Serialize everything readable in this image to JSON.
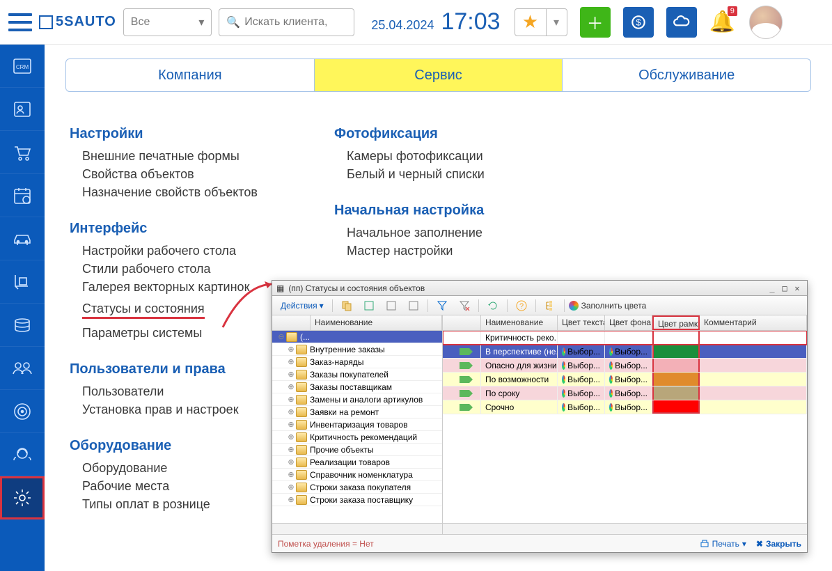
{
  "header": {
    "logo_text": "5SAUTO",
    "filter_value": "Все",
    "search_placeholder": "Искать клиента, ",
    "date": "25.04.2024",
    "time": "17:03",
    "notification_count": "9"
  },
  "sidebar_icons": [
    {
      "name": "crm-icon",
      "label": "CRM"
    },
    {
      "name": "contacts-icon"
    },
    {
      "name": "cart-icon"
    },
    {
      "name": "calendar-icon"
    },
    {
      "name": "car-icon"
    },
    {
      "name": "dolly-icon"
    },
    {
      "name": "coins-icon"
    },
    {
      "name": "group-icon"
    },
    {
      "name": "target-icon"
    },
    {
      "name": "headset-icon"
    },
    {
      "name": "settings-icon",
      "active": true
    }
  ],
  "tabs": [
    {
      "label": "Компания",
      "active": false
    },
    {
      "label": "Сервис",
      "active": true
    },
    {
      "label": "Обслуживание",
      "active": false
    }
  ],
  "settings_columns": {
    "left": [
      {
        "title": "Настройки",
        "items": [
          "Внешние печатные формы",
          "Свойства объектов",
          "Назначение свойств объектов"
        ]
      },
      {
        "title": "Интерфейс",
        "items": [
          "Настройки рабочего стола",
          "Стили рабочего стола",
          "Галерея векторных картинок",
          {
            "text": "Статусы и состояния",
            "highlight": true
          },
          "Параметры системы"
        ]
      },
      {
        "title": "Пользователи и права",
        "items": [
          "Пользователи",
          "Установка прав и настроек"
        ]
      },
      {
        "title": "Оборудование",
        "items": [
          "Оборудование",
          "Рабочие места",
          "Типы оплат в рознице"
        ]
      }
    ],
    "right": [
      {
        "title": "Фотофиксация",
        "items": [
          "Камеры фотофиксации",
          "Белый и черный списки"
        ]
      },
      {
        "title": "Начальная настройка",
        "items": [
          "Начальное заполнение",
          "Мастер настройки"
        ]
      }
    ]
  },
  "modal": {
    "title": "(пп) Статусы и состояния объектов",
    "toolbar": {
      "actions_label": "Действия",
      "fill_colors_label": "Заполнить цвета"
    },
    "left_grid": {
      "header": "Наименование",
      "root": "(...",
      "items": [
        "Внутренние заказы",
        "Заказ-наряды",
        "Заказы покупателей",
        "Заказы поставщикам",
        "Замены и аналоги артикулов",
        "Заявки на ремонт",
        "Инвентаризация товаров",
        "Критичность рекомендаций",
        "Прочие объекты",
        "Реализации товаров",
        "Справочник номенклатура",
        "Строки заказа покупателя",
        "Строки заказа поставщику"
      ]
    },
    "right_grid": {
      "headers": [
        "",
        "Наименование",
        "Цвет текста",
        "Цвет фона",
        "Цвет рамки",
        "Комментарий"
      ],
      "rows": [
        {
          "name": "Критичность реко...",
          "text_color": "",
          "bg": "",
          "frame": "",
          "bg_color": "",
          "top": true
        },
        {
          "name": "В перспективе (не...",
          "text_color": "Выбор...",
          "bg": "Выбор...",
          "frame": "#1a8f3c",
          "bg_color": "#4a5fbf"
        },
        {
          "name": "Опасно для жизни...",
          "text_color": "Выбор...",
          "bg": "Выбор...",
          "frame": "#f3b0b7",
          "bg_color": "#f7d6db"
        },
        {
          "name": "По возможности",
          "text_color": "Выбор...",
          "bg": "Выбор...",
          "frame": "#e08b2c",
          "bg_color": "#ffffcc"
        },
        {
          "name": "По сроку",
          "text_color": "Выбор...",
          "bg": "Выбор...",
          "frame": "#b8a67a",
          "bg_color": "#f7d6db"
        },
        {
          "name": "Срочно",
          "text_color": "Выбор...",
          "bg": "Выбор...",
          "frame": "#ff0000",
          "bg_color": "#ffffcc"
        }
      ]
    },
    "footer": {
      "deletion_mark": "Пометка удаления = Нет",
      "print_label": "Печать",
      "close_label": "Закрыть"
    }
  }
}
